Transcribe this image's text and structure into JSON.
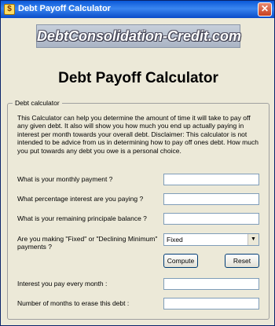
{
  "window": {
    "title": "Debt Payoff Calculator",
    "close_glyph": "✕",
    "app_icon_glyph": "$"
  },
  "banner": {
    "text": "DebtConsolidation-Credit.com"
  },
  "heading": "Debt Payoff Calculator",
  "group": {
    "legend": "Debt calculator",
    "description": "This Calculator can help you determine the amount of time it will take to pay off any given debt. It also will show you how much you end up actually paying in interest per month towards your overall debt. Disclaimer: This calculator is not intended to be advice from us in determining how to pay off ones debt. How much you put towards any debt you owe is a personal choice."
  },
  "form": {
    "monthly_payment_label": "What is your monthly payment ?",
    "monthly_payment_value": "",
    "interest_rate_label": "What percentage interest are you paying ?",
    "interest_rate_value": "",
    "principal_label": "What is your remaining principale balance ?",
    "principal_value": "",
    "payment_type_label": "Are you making \"Fixed\" or \"Declining Minimum\" payments ?",
    "payment_type_value": "Fixed",
    "compute_label": "Compute",
    "reset_label": "Reset",
    "monthly_interest_label": "Interest you pay every month :",
    "monthly_interest_value": "",
    "months_label": "Number of months to erase this debt :",
    "months_value": ""
  }
}
